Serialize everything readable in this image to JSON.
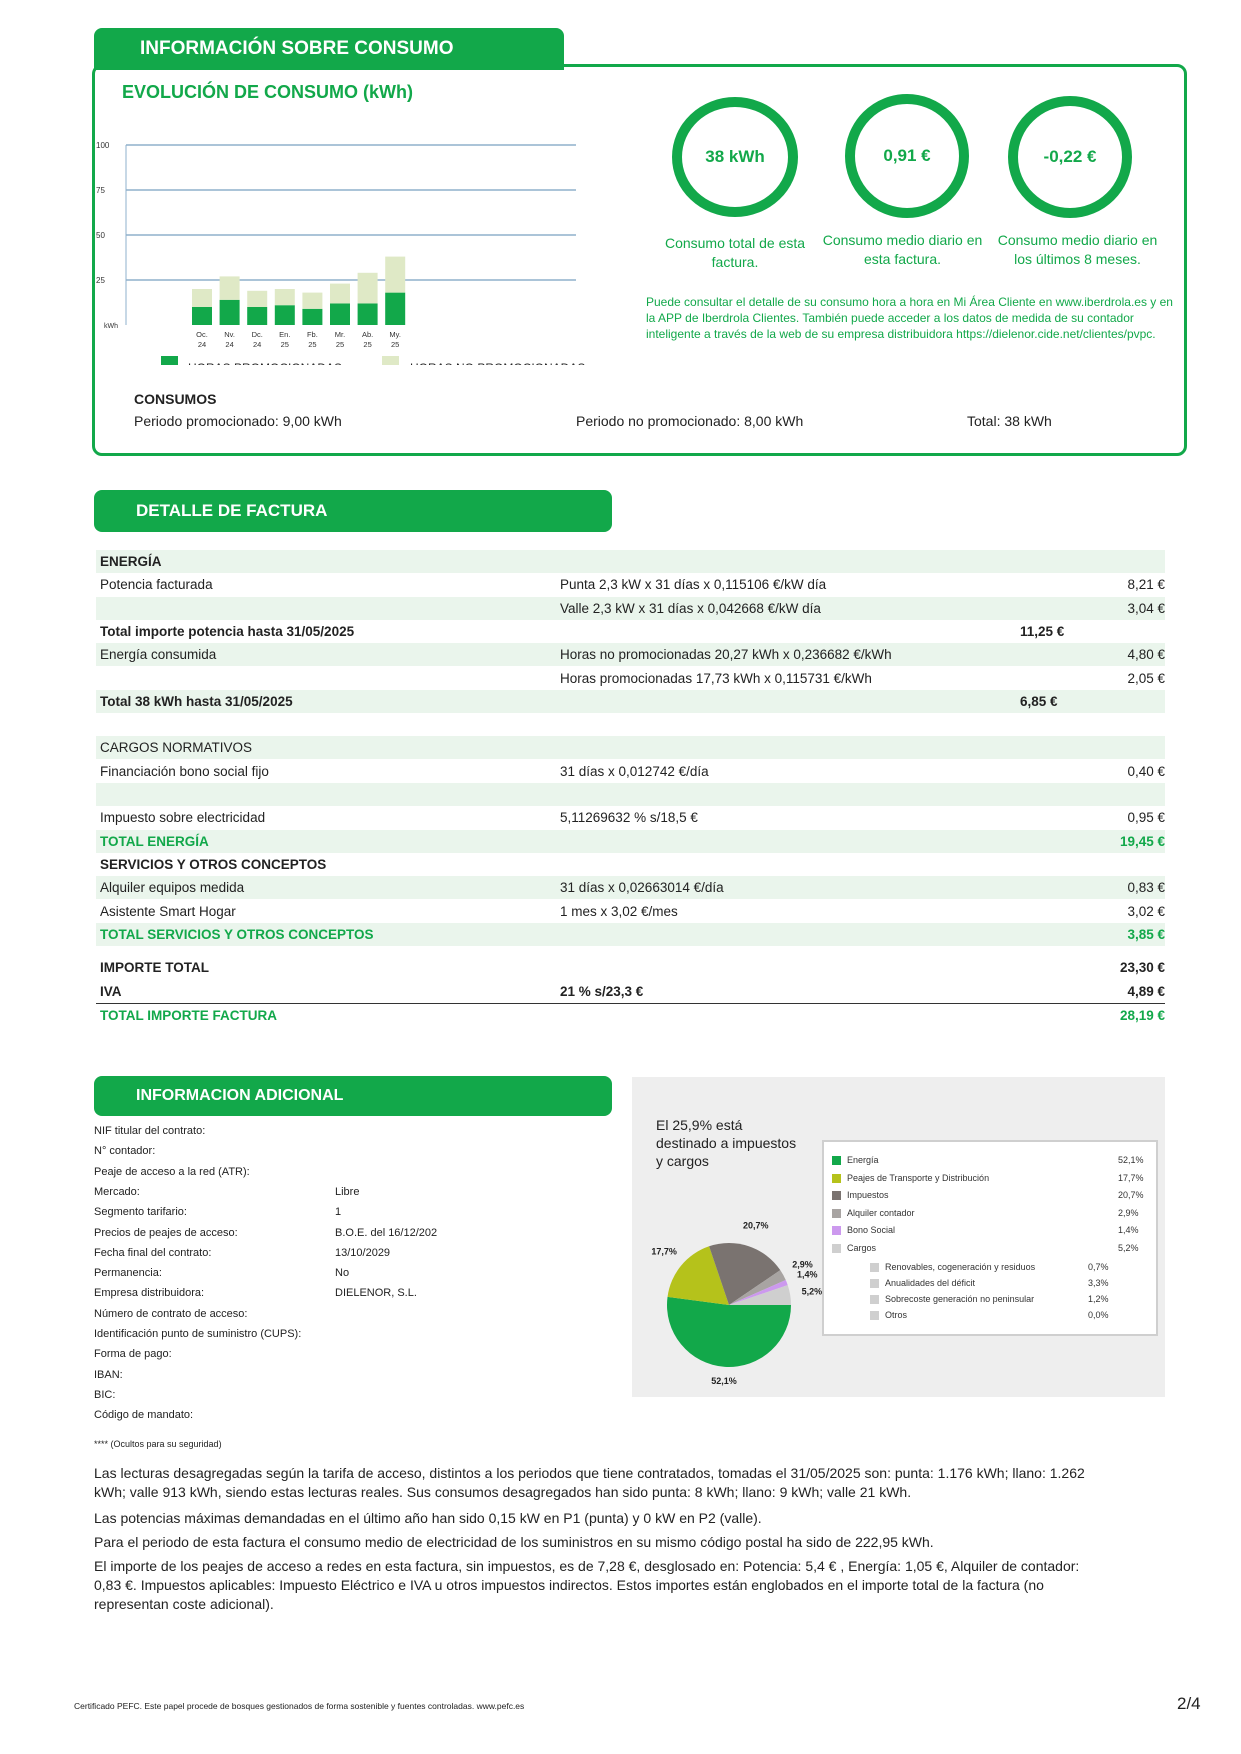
{
  "consumo": {
    "tab_title": "INFORMACIÓN SOBRE CONSUMO",
    "chart_title": "EVOLUCIÓN DE CONSUMO (kWh)",
    "circles": [
      {
        "value": "38 kWh",
        "label": "Consumo total de esta factura."
      },
      {
        "value": "0,91 €",
        "label": "Consumo medio diario en esta factura."
      },
      {
        "value": "-0,22 €",
        "label": "Consumo medio diario en los últimos 8 meses."
      }
    ],
    "note": "Puede consultar el detalle de su consumo hora a hora en Mi Área Cliente en www.iberdrola.es y en la APP de Iberdrola Clientes. También puede acceder a los datos de medida de su contador inteligente a través de la web de su empresa distribuidora https://dielenor.cide.net/clientes/pvpc.",
    "consumos_title": "CONSUMOS",
    "periodo_promocionado": "Periodo promocionado: 9,00 kWh",
    "periodo_no_promocionado": "Periodo no promocionado: 8,00 kWh",
    "total": "Total: 38 kWh",
    "colors": {
      "green": "#12a84a",
      "light": "#dfe9c6"
    }
  },
  "chart_data": {
    "type": "bar",
    "stacked": true,
    "ylabel": "kWh",
    "ylim": [
      0,
      100
    ],
    "yticks": [
      "100",
      "75",
      "50",
      "25",
      "kWh"
    ],
    "categories": [
      [
        "Oc.",
        "24"
      ],
      [
        "Nv.",
        "24"
      ],
      [
        "Dc.",
        "24"
      ],
      [
        "En.",
        "25"
      ],
      [
        "Fb.",
        "25"
      ],
      [
        "Mr.",
        "25"
      ],
      [
        "Ab.",
        "25"
      ],
      [
        "My.",
        "25"
      ]
    ],
    "series": [
      {
        "name": "HORAS PROMOCIONADAS",
        "color": "#12a84a",
        "values": [
          10,
          14,
          10,
          11,
          9,
          12,
          12,
          18
        ]
      },
      {
        "name": "HORAS NO PROMOCIONADAS",
        "color": "#dfe9c6",
        "values": [
          10,
          13,
          9,
          9,
          9,
          11,
          17,
          20
        ]
      }
    ]
  },
  "detalle": {
    "tab_title": "DETALLE DE FACTURA",
    "rows": [
      {
        "c1": "ENERGÍA",
        "c2": "",
        "c3": "",
        "c4": "",
        "style": "bold shade"
      },
      {
        "c1": "Potencia facturada",
        "c2": "Punta 2,3 kW x 31 días x 0,115106 €/kW día",
        "c3": "",
        "c4": "8,21 €",
        "style": ""
      },
      {
        "c1": "",
        "c2": "Valle 2,3 kW x 31 días x 0,042668 €/kW día",
        "c3": "",
        "c4": "3,04 €",
        "style": "shade"
      },
      {
        "c1": "Total importe potencia hasta 31/05/2025",
        "c2": "",
        "c3": "11,25 €",
        "c4": "",
        "style": "bold"
      },
      {
        "c1": "Energía consumida",
        "c2": "Horas no promocionadas 20,27 kWh x 0,236682 €/kWh",
        "c3": "",
        "c4": "4,80 €",
        "style": "shade"
      },
      {
        "c1": "",
        "c2": "Horas promocionadas 17,73 kWh x 0,115731 €/kWh",
        "c3": "",
        "c4": "2,05 €",
        "style": ""
      },
      {
        "c1": "Total 38 kWh hasta 31/05/2025",
        "c2": "",
        "c3": "6,85 €",
        "c4": "",
        "style": "bold shade"
      },
      {
        "c1": "",
        "c2": "",
        "c3": "",
        "c4": "",
        "style": ""
      },
      {
        "c1": "CARGOS NORMATIVOS",
        "c2": "",
        "c3": "",
        "c4": "",
        "style": "shade"
      },
      {
        "c1": "Financiación bono social fijo",
        "c2": "31 días x 0,012742 €/día",
        "c3": "",
        "c4": "0,40 €",
        "style": ""
      },
      {
        "c1": "",
        "c2": "",
        "c3": "",
        "c4": "",
        "style": "shade"
      },
      {
        "c1": "Impuesto sobre electricidad",
        "c2": "5,11269632 % s/18,5 €",
        "c3": "",
        "c4": "0,95 €",
        "style": ""
      },
      {
        "c1": "TOTAL ENERGÍA",
        "c2": "",
        "c3": "",
        "c4": "19,45 €",
        "style": "tot shade"
      },
      {
        "c1": "SERVICIOS Y OTROS CONCEPTOS",
        "c2": "",
        "c3": "",
        "c4": "",
        "style": "bold"
      },
      {
        "c1": "Alquiler equipos medida",
        "c2": "31 días x 0,02663014 €/día",
        "c3": "",
        "c4": "0,83 €",
        "style": "shade"
      },
      {
        "c1": "Asistente Smart Hogar",
        "c2": "1 mes x 3,02 €/mes",
        "c3": "",
        "c4": "3,02 €",
        "style": ""
      },
      {
        "c1": "TOTAL SERVICIOS Y OTROS CONCEPTOS",
        "c2": "",
        "c3": "",
        "c4": "3,85 €",
        "style": "tot shade"
      }
    ],
    "importe_total_label": "IMPORTE TOTAL",
    "importe_total_value": "23,30 €",
    "iva_label": "IVA",
    "iva_calc": "21 % s/23,3 €",
    "iva_value": "4,89 €",
    "total_factura_label": "TOTAL IMPORTE FACTURA",
    "total_factura_value": "28,19 €"
  },
  "adicional": {
    "tab_title": "INFORMACION ADICIONAL",
    "items": [
      {
        "label": "NIF titular del contrato:",
        "value": ""
      },
      {
        "label": "N° contador:",
        "value": ""
      },
      {
        "label": "Peaje de acceso a la red (ATR):",
        "value": ""
      },
      {
        "label": "Mercado:",
        "value": "Libre"
      },
      {
        "label": "Segmento tarifario:",
        "value": "1"
      },
      {
        "label": "Precios de peajes de acceso:",
        "value": "B.O.E. del 16/12/202"
      },
      {
        "label": "Fecha final del contrato:",
        "value": "13/10/2029"
      },
      {
        "label": "Permanencia:",
        "value": "No"
      },
      {
        "label": "Empresa distribuidora:",
        "value": "DIELENOR, S.L."
      },
      {
        "label": "Número de contrato de acceso:",
        "value": ""
      },
      {
        "label": "Identificación punto de suministro (CUPS):",
        "value": ""
      },
      {
        "label": "Forma de pago:",
        "value": ""
      },
      {
        "label": "IBAN:",
        "value": ""
      },
      {
        "label": "BIC:",
        "value": ""
      },
      {
        "label": "Código de mandato:",
        "value": ""
      }
    ],
    "hidden_note": "**** (Ocultos para su seguridad)"
  },
  "pie": {
    "caption": "El 25,9% está destinado a impuestos y cargos",
    "slices": [
      {
        "name": "Energía",
        "value": 52.1,
        "label": "52,1%",
        "color": "#12a84a"
      },
      {
        "name": "Peajes de Transporte y Distribución",
        "value": 17.7,
        "label": "17,7%",
        "color": "#b5c21b"
      },
      {
        "name": "Impuestos",
        "value": 20.7,
        "label": "20,7%",
        "color": "#7a7370"
      },
      {
        "name": "Alquiler contador",
        "value": 2.9,
        "label": "2,9%",
        "color": "#a8a4a2"
      },
      {
        "name": "Bono Social",
        "value": 1.4,
        "label": "1,4%",
        "color": "#cc99ee"
      },
      {
        "name": "Cargos",
        "value": 5.2,
        "label": "5,2%",
        "color": "#cfcfcf"
      }
    ],
    "sub_legend": [
      {
        "name": "Renovables, cogeneración y residuos",
        "label": "0,7%"
      },
      {
        "name": "Anualidades del déficit",
        "label": "3,3%"
      },
      {
        "name": "Sobrecoste generación no peninsular",
        "label": "1,2%"
      },
      {
        "name": "Otros",
        "label": "0,0%"
      }
    ]
  },
  "paragraphs": [
    "Las lecturas desagregadas según la tarifa de acceso, distintos a los periodos que tiene contratados, tomadas el 31/05/2025 son: punta: 1.176 kWh; llano: 1.262 kWh; valle 913 kWh, siendo estas lecturas reales. Sus consumos desagregados han sido punta: 8 kWh; llano: 9 kWh; valle 21 kWh.",
    "Las potencias máximas demandadas en el último año han sido 0,15 kW en P1 (punta) y 0 kW en P2 (valle).",
    "Para el periodo de esta factura el consumo medio de electricidad de los suministros en su mismo código postal ha sido de 222,95 kWh.",
    "El importe de los peajes de acceso a redes en esta factura, sin impuestos, es de 7,28 €, desglosado en: Potencia: 5,4 € , Energía: 1,05 €, Alquiler de contador: 0,83 €. Impuestos aplicables: Impuesto Eléctrico e IVA u otros impuestos indirectos. Estos importes están englobados en el importe total de la factura (no representan coste adicional)."
  ],
  "footer": {
    "cert": "Certificado PEFC. Este papel procede de bosques gestionados de forma sostenible y fuentes controladas. www.pefc.es",
    "page": "2/4"
  }
}
